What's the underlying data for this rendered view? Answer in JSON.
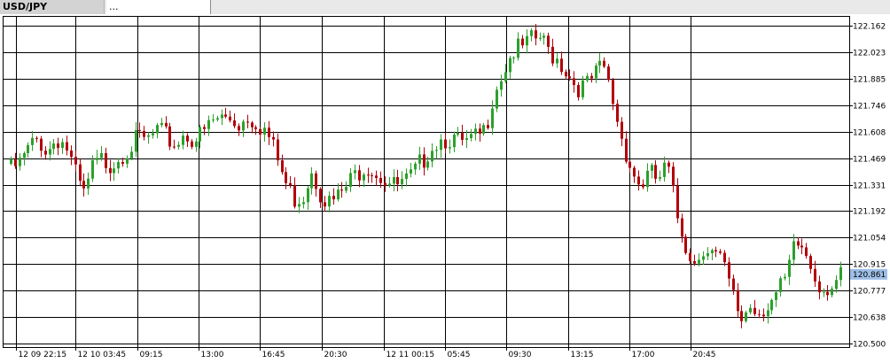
{
  "tabs": [
    {
      "label": "USD/JPY"
    },
    {
      "label": "..."
    }
  ],
  "colors": {
    "up": "#2ca02c",
    "down": "#b2000a",
    "grid": "#000000",
    "current_price_bg": "#9dbee6"
  },
  "chart_data": {
    "type": "candlestick",
    "symbol": "USD/JPY",
    "ylim": [
      120.48,
      122.21
    ],
    "y_ticks": [
      "122.162",
      "122.023",
      "121.885",
      "121.746",
      "121.608",
      "121.469",
      "121.331",
      "121.192",
      "121.054",
      "120.915",
      "120.777",
      "120.638",
      "120.500"
    ],
    "x_ticks": [
      "12 09 22:15",
      "12 10 03:45",
      "09:15",
      "13:00",
      "16:45",
      "20:30",
      "12 11 00:15",
      "05:45",
      "09:30",
      "13:15",
      "17:00",
      "20:45"
    ],
    "current_price": "120.861",
    "close_path": [
      121.44,
      121.47,
      121.55,
      121.6,
      121.53,
      121.61,
      121.57,
      121.42,
      121.3,
      121.45,
      121.49,
      121.47,
      121.52,
      121.56,
      121.6,
      121.59,
      121.64,
      121.61,
      121.57,
      121.63,
      121.6,
      121.62,
      121.69,
      121.71,
      121.71,
      121.68,
      121.72,
      121.69,
      121.64,
      121.52,
      121.38,
      121.29,
      121.3,
      121.45,
      121.32,
      121.26,
      121.3,
      121.36,
      121.43,
      121.47,
      121.43,
      121.39,
      121.35,
      121.36,
      121.4,
      121.48,
      121.56,
      121.6,
      121.61,
      121.58,
      121.57,
      121.6,
      121.64,
      121.86,
      121.96,
      122.06,
      122.07,
      122.11,
      122.13,
      122.06,
      122.02,
      121.95,
      121.88,
      121.87,
      121.93,
      121.98,
      121.8,
      121.6,
      121.45,
      121.35,
      121.42,
      121.38,
      121.46,
      121.2,
      121.05,
      120.95,
      121.05,
      121.0,
      120.95,
      120.8,
      120.65,
      120.73,
      120.7,
      120.74,
      120.78,
      120.86,
      121.05,
      121.02,
      120.9,
      120.82,
      120.84,
      120.87
    ]
  }
}
